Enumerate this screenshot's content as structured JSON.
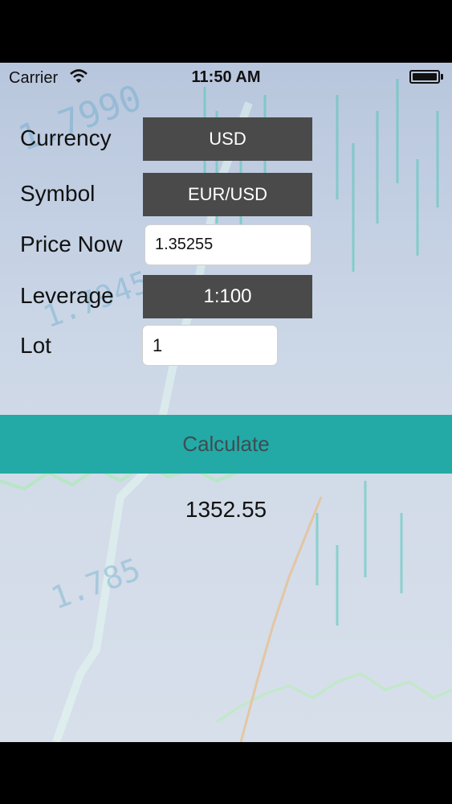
{
  "status_bar": {
    "carrier": "Carrier",
    "time": "11:50 AM"
  },
  "form": {
    "currency": {
      "label": "Currency",
      "value": "USD"
    },
    "symbol": {
      "label": "Symbol",
      "value": "EUR/USD"
    },
    "price_now": {
      "label": "Price Now",
      "value": "1.35255"
    },
    "leverage": {
      "label": "Leverage",
      "value": "1:100"
    },
    "lot": {
      "label": "Lot",
      "value": "1"
    }
  },
  "calculate_label": "Calculate",
  "result": "1352.55",
  "colors": {
    "accent": "#23AAA6",
    "button_dark": "#4A4A4A"
  }
}
